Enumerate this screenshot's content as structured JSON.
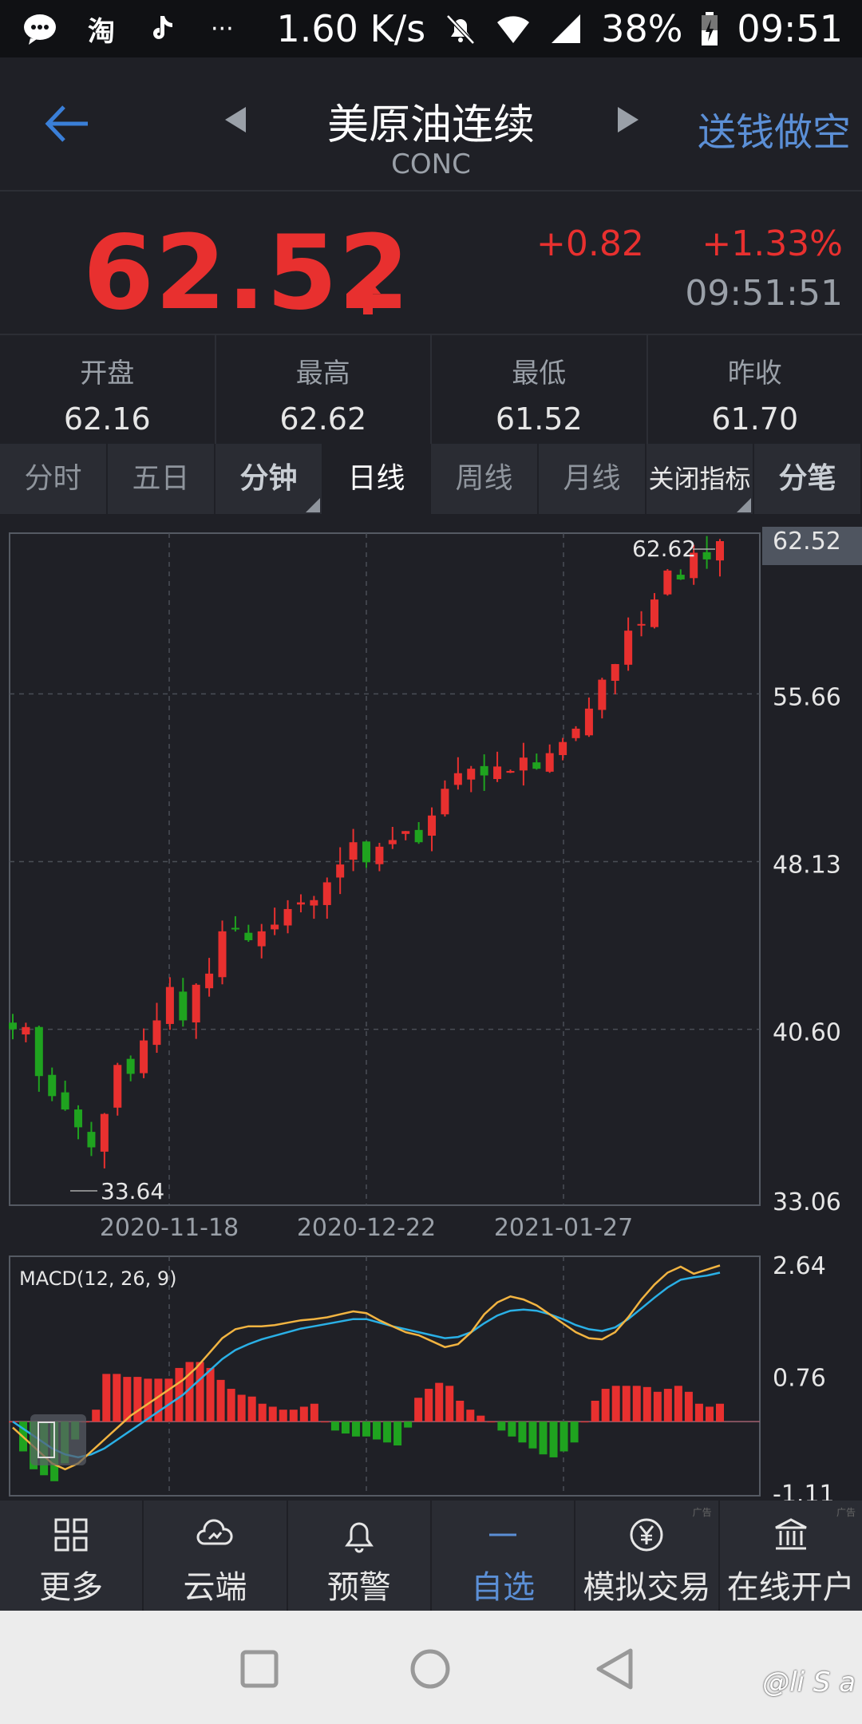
{
  "status": {
    "speed": "1.60 K/s",
    "battery": "38%",
    "time": "09:51",
    "left_text": "淘",
    "more": "···"
  },
  "header": {
    "title": "美原油连续",
    "code": "CONC",
    "action": "送钱做空"
  },
  "quote": {
    "price": "62.52",
    "change": "+0.82",
    "percent": "+1.33%",
    "time": "09:51:51"
  },
  "stats": [
    {
      "label": "开盘",
      "value": "62.16"
    },
    {
      "label": "最高",
      "value": "62.62"
    },
    {
      "label": "最低",
      "value": "61.52"
    },
    {
      "label": "昨收",
      "value": "61.70"
    }
  ],
  "tabs": [
    {
      "label": "分时"
    },
    {
      "label": "五日"
    },
    {
      "label": "分钟"
    },
    {
      "label": "日线"
    },
    {
      "label": "周线"
    },
    {
      "label": "月线"
    },
    {
      "label": "关闭指标"
    },
    {
      "label": "分笔"
    }
  ],
  "chart_data": [
    {
      "type": "candlestick",
      "ylim": [
        33.06,
        62.52
      ],
      "y_ticks": [
        "62.52",
        "55.66",
        "48.13",
        "40.60",
        "33.06"
      ],
      "x_ticks": [
        "2020-11-18",
        "2020-12-22",
        "2021-01-27"
      ],
      "high_label": "62.62",
      "low_label": "33.64",
      "current_label": "62.52",
      "series": [
        {
          "values": [
            40.6,
            40.7,
            38.5,
            37.6,
            37.0,
            36.2,
            35.3,
            36.8,
            39.0,
            38.6,
            40.1,
            41.0,
            42.5,
            41.0,
            42.6,
            43.1,
            45.0,
            45.1,
            44.6,
            45.0,
            45.3,
            46.0,
            46.3,
            46.4,
            47.2,
            48.0,
            49.0,
            48.1,
            48.8,
            49.1,
            49.5,
            49.0,
            50.2,
            51.4,
            52.1,
            52.3,
            52.0,
            52.4,
            52.2,
            52.8,
            52.3,
            53.0,
            53.5,
            54.1,
            55.0,
            56.3,
            57.0,
            58.5,
            58.8,
            59.9,
            61.2,
            60.8,
            62.0,
            61.7,
            62.52
          ]
        }
      ]
    },
    {
      "type": "bar",
      "title": "MACD(12, 26, 9)",
      "ylim": [
        -1.11,
        2.64
      ],
      "y_ticks": [
        "2.64",
        "0.76",
        "-1.11"
      ],
      "macd": [
        0.0,
        -0.5,
        -0.8,
        -0.9,
        -1.0,
        -0.7,
        -0.3,
        0.0,
        0.2,
        0.8,
        0.8,
        0.75,
        0.75,
        0.72,
        0.72,
        0.72,
        0.9,
        1.0,
        1.0,
        0.9,
        0.7,
        0.55,
        0.45,
        0.42,
        0.3,
        0.25,
        0.2,
        0.2,
        0.25,
        0.3,
        0.0,
        -0.15,
        -0.2,
        -0.25,
        -0.25,
        -0.3,
        -0.35,
        -0.4,
        -0.1,
        0.4,
        0.55,
        0.65,
        0.6,
        0.35,
        0.2,
        0.1,
        0.0,
        -0.15,
        -0.25,
        -0.35,
        -0.45,
        -0.55,
        -0.6,
        -0.5,
        -0.35,
        0.0,
        0.35,
        0.55,
        0.6,
        0.6,
        0.6,
        0.58,
        0.5,
        0.55,
        0.6,
        0.5,
        0.3,
        0.25,
        0.3
      ],
      "dif": [
        -0.1,
        -0.3,
        -0.5,
        -0.7,
        -0.8,
        -0.7,
        -0.5,
        -0.3,
        -0.1,
        0.1,
        0.25,
        0.4,
        0.55,
        0.7,
        0.9,
        1.15,
        1.4,
        1.55,
        1.6,
        1.6,
        1.62,
        1.66,
        1.7,
        1.72,
        1.75,
        1.8,
        1.85,
        1.82,
        1.7,
        1.6,
        1.5,
        1.45,
        1.35,
        1.25,
        1.3,
        1.5,
        1.8,
        2.0,
        2.1,
        2.05,
        1.95,
        1.8,
        1.65,
        1.5,
        1.4,
        1.38,
        1.5,
        1.75,
        2.05,
        2.3,
        2.5,
        2.6,
        2.48,
        2.55,
        2.62
      ],
      "dea": [
        0.0,
        -0.15,
        -0.3,
        -0.45,
        -0.55,
        -0.6,
        -0.55,
        -0.45,
        -0.3,
        -0.15,
        0.0,
        0.15,
        0.3,
        0.45,
        0.65,
        0.85,
        1.05,
        1.2,
        1.3,
        1.38,
        1.44,
        1.5,
        1.56,
        1.6,
        1.64,
        1.68,
        1.72,
        1.72,
        1.66,
        1.6,
        1.55,
        1.5,
        1.45,
        1.4,
        1.42,
        1.5,
        1.65,
        1.78,
        1.86,
        1.88,
        1.86,
        1.8,
        1.72,
        1.62,
        1.55,
        1.52,
        1.58,
        1.72,
        1.9,
        2.08,
        2.25,
        2.38,
        2.42,
        2.45,
        2.5
      ]
    }
  ],
  "bottom_nav": [
    {
      "label": "更多",
      "icon": "grid-icon"
    },
    {
      "label": "云端",
      "icon": "cloud-icon"
    },
    {
      "label": "预警",
      "icon": "bell-icon"
    },
    {
      "label": "自选",
      "icon": "minus-icon"
    },
    {
      "label": "模拟交易",
      "icon": "yen-icon"
    },
    {
      "label": "在线开户",
      "icon": "bank-icon"
    }
  ],
  "watermark": "@li S a",
  "ad_tag": "广告",
  "colors": {
    "up": "#e8302f",
    "down": "#1fa31f",
    "accent": "#5b8fd6",
    "dif": "#f2b441",
    "dea": "#2ab0e6"
  }
}
